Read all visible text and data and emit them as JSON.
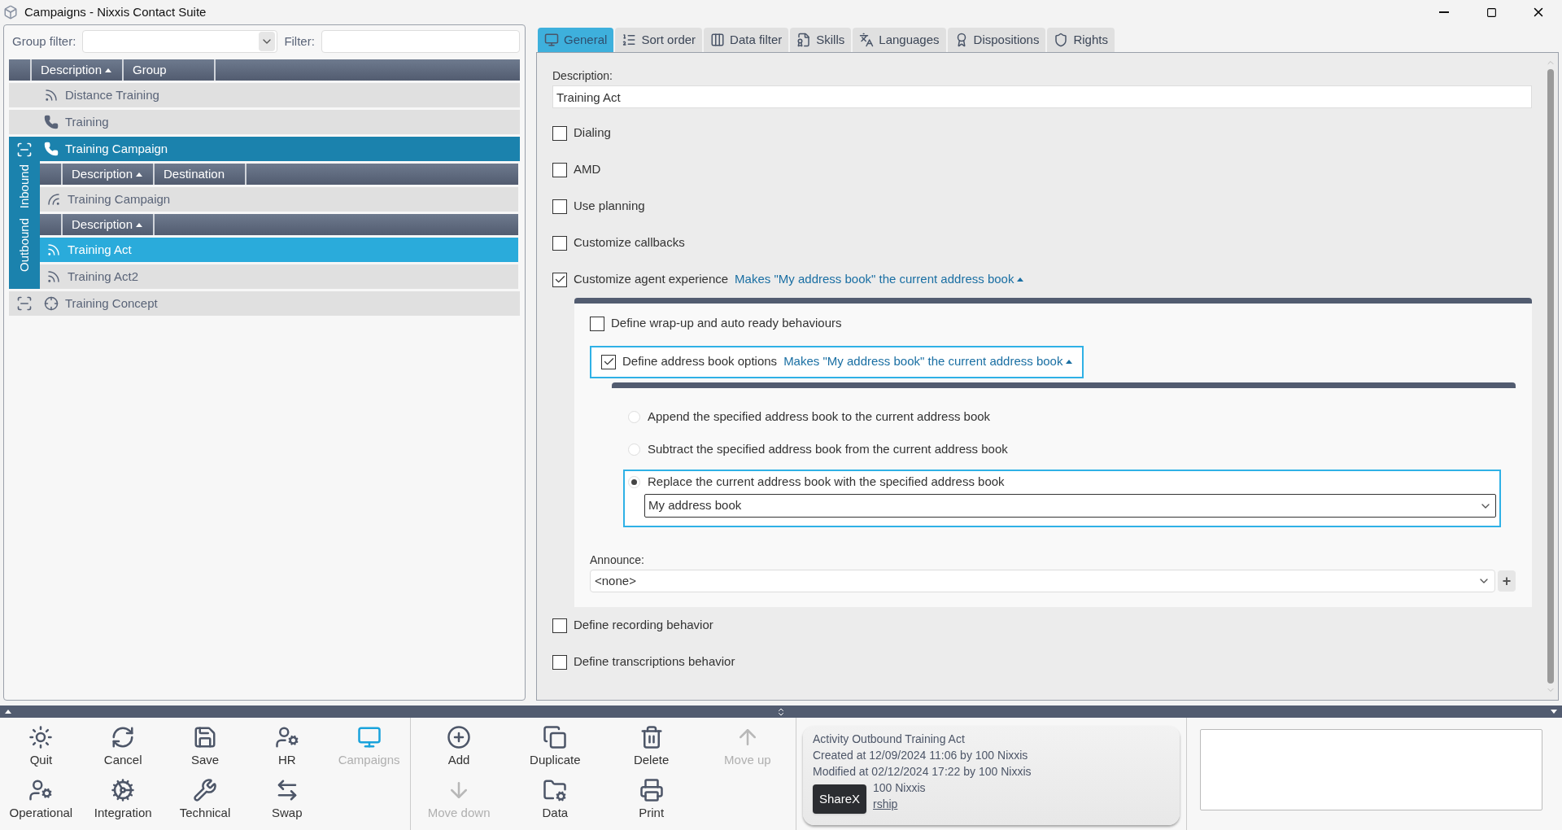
{
  "window": {
    "title": "Campaigns - Nixxis Contact Suite"
  },
  "left": {
    "group_filter_label": "Group filter:",
    "filter_label": "Filter:",
    "columns": [
      {
        "label": "Description",
        "sorted": true
      },
      {
        "label": "Group",
        "sorted": false
      }
    ],
    "rows": [
      {
        "label": "Distance Training",
        "kind": "signal",
        "selected": false
      },
      {
        "label": "Training",
        "kind": "phone",
        "selected": false
      },
      {
        "label": "Training Campaign",
        "kind": "phone",
        "selected": true,
        "expanded": true,
        "side_tabs": [
          "Outbound",
          "Inbound"
        ],
        "inbound": {
          "columns": [
            {
              "label": "Description",
              "sorted": true
            },
            {
              "label": "Destination",
              "sorted": false
            }
          ],
          "rows": [
            {
              "label": "Training Campaign",
              "kind": "inbound",
              "selected": false
            }
          ]
        },
        "outbound": {
          "columns": [
            {
              "label": "Description",
              "sorted": true
            }
          ],
          "rows": [
            {
              "label": "Training Act",
              "kind": "signal",
              "selected": true
            },
            {
              "label": "Training Act2",
              "kind": "signal",
              "selected": false
            }
          ]
        }
      },
      {
        "label": "Training Concept",
        "kind": "target",
        "selected": false,
        "expanded": false
      }
    ]
  },
  "tabs": [
    {
      "label": "General",
      "selected": true
    },
    {
      "label": "Sort order",
      "selected": false
    },
    {
      "label": "Data filter",
      "selected": false
    },
    {
      "label": "Skills",
      "selected": false
    },
    {
      "label": "Languages",
      "selected": false
    },
    {
      "label": "Dispositions",
      "selected": false
    },
    {
      "label": "Rights",
      "selected": false
    }
  ],
  "form": {
    "description_label": "Description:",
    "description_value": "Training Act",
    "options": [
      {
        "label": "Dialing",
        "checked": false
      },
      {
        "label": "AMD",
        "checked": false
      },
      {
        "label": "Use planning",
        "checked": false
      },
      {
        "label": "Customize callbacks",
        "checked": false
      },
      {
        "label": "Customize agent experience",
        "checked": true,
        "summary": "Makes \"My address book\" the current address book",
        "expanded": true,
        "children": [
          {
            "label": "Define wrap-up and auto ready behaviours",
            "checked": false
          },
          {
            "label": "Define address book options",
            "checked": true,
            "focused": true,
            "summary": "Makes \"My address book\" the current address book",
            "expanded": true,
            "radios": [
              {
                "label": "Append the specified address book to the current address book",
                "selected": false
              },
              {
                "label": "Subtract the specified address book from the current address book",
                "selected": false
              },
              {
                "label": "Replace the current address book with the specified address book",
                "selected": true,
                "value": "My address book"
              }
            ]
          }
        ],
        "announce_label": "Announce:",
        "announce_value": "<none>",
        "announce_add": "+"
      },
      {
        "label": "Define recording behavior",
        "checked": false
      },
      {
        "label": "Define transcriptions behavior",
        "checked": false
      }
    ]
  },
  "toolbar": {
    "nav": [
      {
        "label": "Quit",
        "selected": false
      },
      {
        "label": "Cancel",
        "selected": false
      },
      {
        "label": "Save",
        "selected": false
      },
      {
        "label": "HR",
        "selected": false
      },
      {
        "label": "Campaigns",
        "selected": true
      },
      {
        "label": "Operational",
        "selected": false
      },
      {
        "label": "Integration",
        "selected": false
      },
      {
        "label": "Technical",
        "selected": false
      },
      {
        "label": "Swap",
        "selected": false
      }
    ],
    "actions": [
      {
        "label": "Add",
        "disabled": false
      },
      {
        "label": "Duplicate",
        "disabled": false
      },
      {
        "label": "Delete",
        "disabled": false
      },
      {
        "label": "Move up",
        "disabled": true
      },
      {
        "label": "Move down",
        "disabled": true
      },
      {
        "label": "Data",
        "disabled": false
      },
      {
        "label": "Print",
        "disabled": false
      }
    ]
  },
  "info": {
    "lines": [
      "Activity Outbound Training Act",
      "Created at 12/09/2024 11:06 by 100 Nixxis",
      "Modified at 02/12/2024 17:22 by 100 Nixxis"
    ],
    "partial_line": "100 Nixxis",
    "partial_link": "rship",
    "tooltip": "ShareX"
  }
}
